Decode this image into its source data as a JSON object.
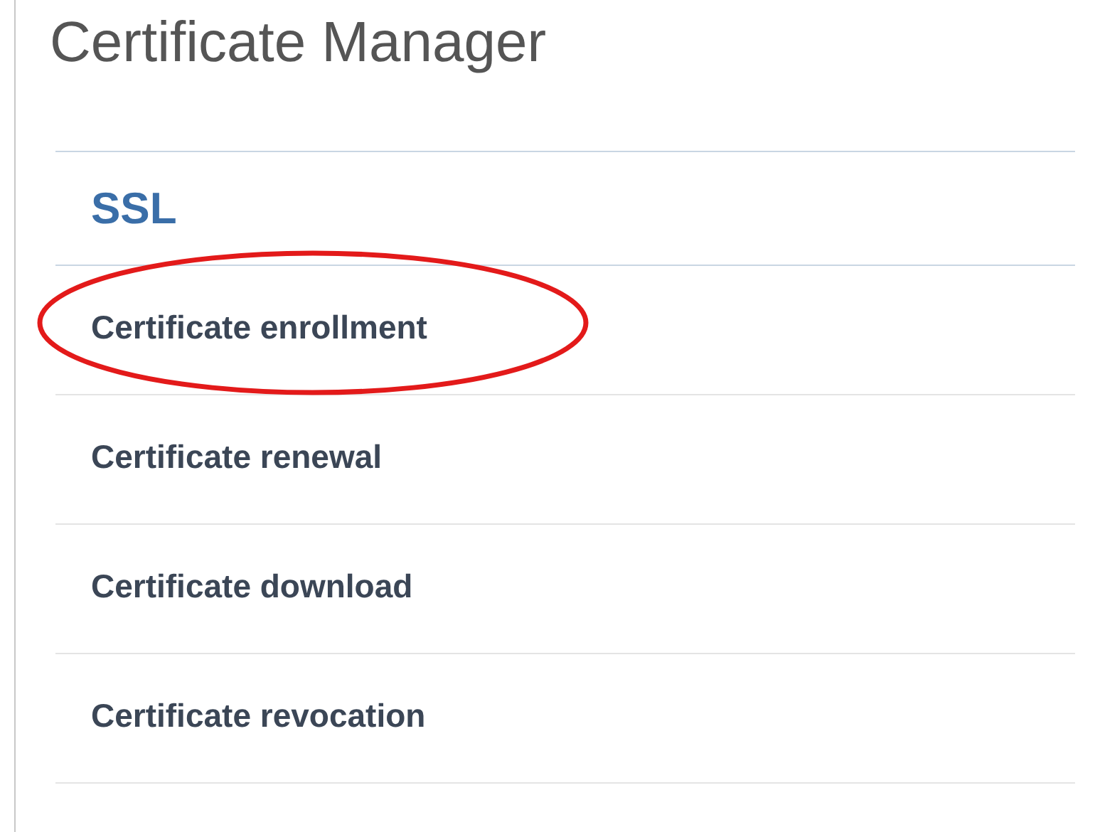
{
  "title": "Certificate Manager",
  "section": {
    "heading": "SSL",
    "items": [
      {
        "label": "Certificate enrollment",
        "highlighted": true
      },
      {
        "label": "Certificate renewal",
        "highlighted": false
      },
      {
        "label": "Certificate download",
        "highlighted": false
      },
      {
        "label": "Certificate revocation",
        "highlighted": false
      }
    ]
  }
}
